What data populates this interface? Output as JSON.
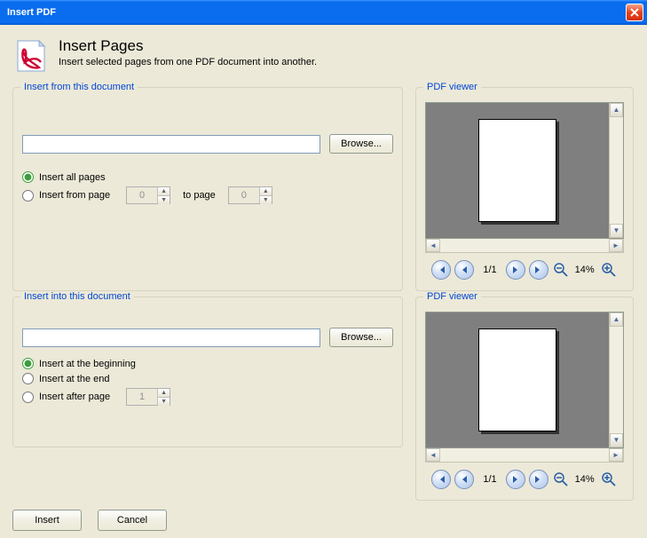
{
  "window": {
    "title": "Insert PDF"
  },
  "header": {
    "title": "Insert Pages",
    "subtitle": "Insert selected pages from one PDF document into another."
  },
  "groups": {
    "from": {
      "title": "Insert from this document",
      "browse": "Browse...",
      "opt_all": "Insert all pages",
      "opt_range": "Insert from page",
      "range_to": "to page",
      "from_val": "0",
      "to_val": "0"
    },
    "into": {
      "title": "Insert into this document",
      "browse": "Browse...",
      "opt_begin": "Insert at the beginning",
      "opt_end": "Insert at the end",
      "opt_after": "Insert after page",
      "after_val": "1"
    },
    "viewer1": {
      "title": "PDF viewer",
      "page": "1/1",
      "zoom": "14%"
    },
    "viewer2": {
      "title": "PDF viewer",
      "page": "1/1",
      "zoom": "14%"
    }
  },
  "actions": {
    "insert": "Insert",
    "cancel": "Cancel"
  }
}
